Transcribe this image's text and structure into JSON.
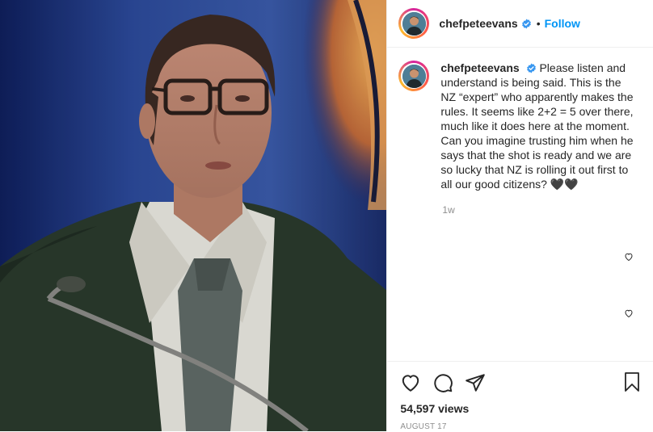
{
  "post": {
    "username": "chefpeteevans",
    "follow_label": "Follow",
    "dot": "•",
    "caption": "Please listen and understand is being said. This is the NZ “expert” who apparently makes the rules. It seems like 2+2 = 5 over there, much like it does here at the moment. Can you imagine trusting him when he says that the shot is ready and we are so lucky that NZ is rolling it out first to all our good citizens? 🖤🖤",
    "time_ago": "1w",
    "views": "54,597 views",
    "date": "AUGUST 17"
  },
  "icons": {
    "verified": "verified-badge-icon",
    "like": "heart-icon",
    "comment": "comment-icon",
    "share": "paper-plane-icon",
    "save": "bookmark-icon",
    "comment_like": "small-heart-icon"
  },
  "colors": {
    "accent": "#0095f6",
    "text": "#262626",
    "muted": "#8e8e8e",
    "border": "#efefef"
  }
}
